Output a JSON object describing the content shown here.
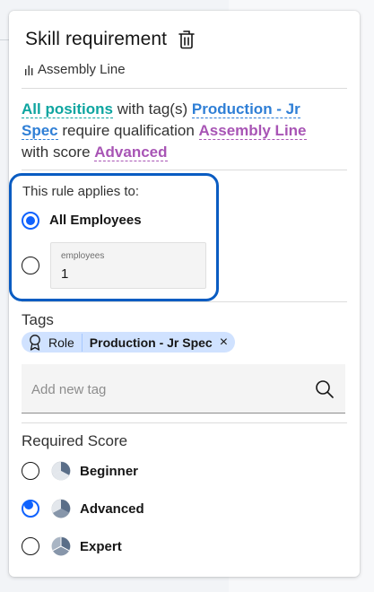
{
  "panel": {
    "title": "Skill requirement",
    "subtitle": "Assembly Line"
  },
  "summary": {
    "scope": "All positions",
    "text_1": " with tag(s) ",
    "tag": "Production - Jr Spec",
    "text_2": "  require qualification ",
    "qualification": "Assembly Line",
    "text_3": " with score ",
    "score": "Advanced"
  },
  "applies": {
    "label": "This rule applies to:",
    "option_all": "All Employees",
    "option_all_selected": true,
    "employees_label": "employees",
    "employees_value": "1"
  },
  "tags": {
    "label": "Tags",
    "items": [
      {
        "type": "Role",
        "value": "Production - Jr Spec",
        "remove": "×"
      }
    ],
    "input_placeholder": "Add new tag"
  },
  "score": {
    "label": "Required Score",
    "options": [
      {
        "label": "Beginner",
        "selected": false
      },
      {
        "label": "Advanced",
        "selected": true
      },
      {
        "label": "Expert",
        "selected": false
      }
    ]
  },
  "colors": {
    "accent": "#0f62fe",
    "focus_ring": "#0a5cc2",
    "scope": "#0ea5a0",
    "tag": "#2f7fd6",
    "qualification": "#a855b5",
    "pill_bg": "#d0e2ff"
  }
}
